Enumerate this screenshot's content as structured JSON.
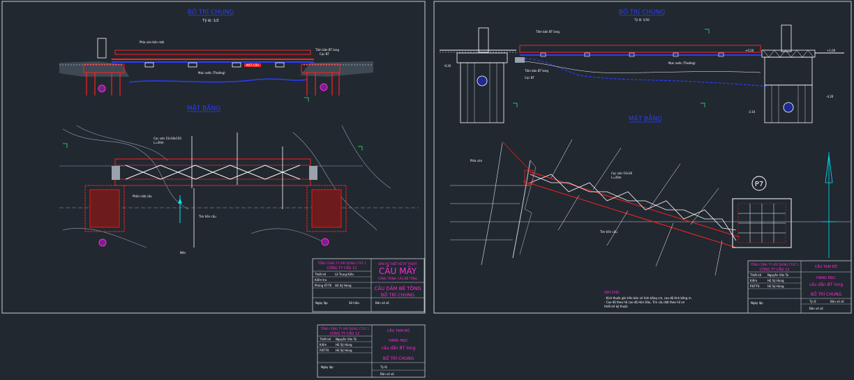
{
  "sheet_left": {
    "title_elevation": "BỐ TRÍ CHUNG",
    "scale_note": "Tỷ lệ: 1/2",
    "title_plan": "MẶT BẰNG",
    "labels": {
      "girder": "Phía ván bản mặt",
      "tree_box": "Tấm bản BT long",
      "pile": "Cọc BT",
      "water": "Mực nước (Thường)",
      "center": "MẶT CẦU",
      "pile_note": "Cọc ván 15x18x150",
      "pile_len": "L=20m",
      "support": "Phần mặt cầu",
      "hinge": "Tim tiền cầu",
      "pile_group": "Nền"
    },
    "title_block": {
      "company_top": "TỔNG CÔNG TY XÂY DỰNG CTGT 1",
      "company": "CÔNG TY CẦU 12",
      "project_line1": "BẢN VẼ THIẾT KẾ KỸ THUẬT",
      "project_big": "CẦU MÂY",
      "project_line3": "CÔNG TRÌNH: CẦU BÊ TÔNG",
      "drawing_line1": "CẦU DẦM BÊ TÔNG",
      "drawing_line2": "BỐ TRÍ CHUNG",
      "row1_label": "Thiết kế",
      "row1_value": "Lê Trung Kiên",
      "row2_label": "Kiểm tra",
      "row3_label": "Phòng KT-TK",
      "row3_value": "Hồ Sỹ Hùng",
      "footer_a": "Ngày lập",
      "footer_b": "Số hiệu",
      "footer_c": "Bản vẽ số"
    }
  },
  "sheet_right": {
    "title_elevation": "BỐ TRÍ CHUNG",
    "scale_note": "Tỷ lệ: 1/50",
    "title_plan": "MẶT BẰNG",
    "labels": {
      "deck": "Tấm bản BT long",
      "slab": "Tấm bản BT long",
      "pile_box": "Cọc BT",
      "water": "Mực nước (Thường)",
      "pier_tag": "P7",
      "pile_note": "Cọc ván 15x18",
      "pile_len": "L=20m",
      "shore": "Phía ván",
      "span": "Tim tiền cầu",
      "notes_title": "GHI CHÚ",
      "note1": "- Kích thước ghi trên bản vẽ tính bằng cm, cao độ tính bằng m.",
      "note2": "- Cao độ theo hệ cao độ Hòn Dấu, Tim cầu đặt theo hồ sơ",
      "note3": "thiết kế kỹ thuật."
    },
    "elev_marks": [
      "+1.00",
      "-0.20",
      "+0.20",
      "-3.10",
      "-4.20"
    ],
    "title_block": {
      "company_top": "TỔNG CÔNG TY XÂY DỰNG CTGT 1",
      "company": "CÔNG TY CẦU 12",
      "project": "CẦU TẠM ĐÔ",
      "drawing_line1": "HẠNG MỤC",
      "drawing_line2": "cầu dẫn BT long",
      "drawing_line3": "BỐ TRÍ CHUNG",
      "row1_label": "Thiết kế",
      "row1_value": "Nguyễn Văn Tú",
      "row2_label": "Kiểm",
      "row2_value": "Hồ Sỹ Hùng",
      "row3_label": "P.KT-TK",
      "row3_value": "Hồ Sỹ Hùng",
      "footer_a": "Ngày lập",
      "footer_b": "Tỷ lệ",
      "footer_c": "Bản vẽ số",
      "footer_d": "Bản vẽ số"
    }
  },
  "floating_block": {
    "company_top": "TỔNG CÔNG TY XÂY DỰNG CTGT 1",
    "company": "CÔNG TY CẦU 12",
    "project": "CẦU TẠM ĐÔ",
    "drawing_line1": "HẠNG MỤC",
    "drawing_line2": "cầu dẫn BT long",
    "drawing_line3": "BỐ TRÍ CHUNG",
    "row1_label": "Thiết kế",
    "row1_value": "Nguyễn Văn Tú",
    "row2_label": "Kiểm",
    "row2_value": "Hồ Sỹ Hùng",
    "row3_label": "P.KT-TK",
    "row3_value": "Hồ Sỹ Hùng",
    "footer_a": "Ngày lập",
    "footer_b": "Tỷ lệ",
    "footer_c": "Bản vẽ số"
  },
  "colors": {
    "background": "#212830",
    "frame": "#c9d0d6",
    "structure": "#ff2020",
    "water": "#2a3dff",
    "title": "#2a3dff",
    "annotation": "#ffffff",
    "magenta": "#ff2bd6",
    "axis": "#00e5ff",
    "cyan": "#22d3ee",
    "green": "#22c55e"
  }
}
